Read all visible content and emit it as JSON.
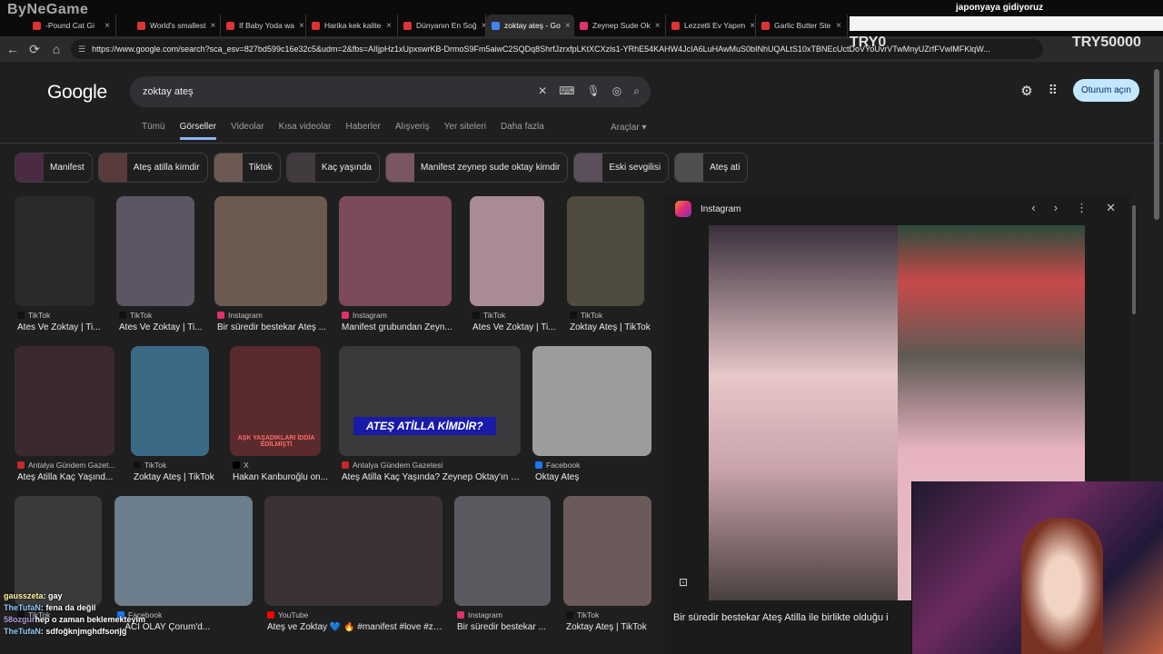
{
  "browser": {
    "tabs": [
      {
        "label": "-Pound Cat Gi",
        "color": "#d33"
      },
      {
        "label": "World's smallest",
        "color": "#d33"
      },
      {
        "label": "If Baby Yoda wa",
        "color": "#d33"
      },
      {
        "label": "Harika kek kalite",
        "color": "#d33"
      },
      {
        "label": "Dünyanın En Soğ",
        "color": "#d33"
      },
      {
        "label": "zoktay ateş - Go",
        "color": "#4285f4"
      },
      {
        "label": "Zeynep Sude Ok",
        "color": "#e1306c"
      },
      {
        "label": "Lezzetli Ev Yapım",
        "color": "#d33"
      },
      {
        "label": "Garlic Butter Ste",
        "color": "#d33"
      }
    ],
    "url": "https://www.google.com/search?sca_esv=827bd599c16e32c5&udm=2&fbs=AIIjpHz1xUpxswrKB-DrmoS9Fm5aiwC2SQDq8ShrfJzrxfpLKtXCXzls1-YRhE54KAHW4JcIA6LuHAwMuS0bINhUQALtS10xTBNEcUctDoVYoUvrVTwMnyUZrfFVwlMFKlqW..."
  },
  "stream": {
    "logo": "ByNeGame",
    "goal_text": "japonyaya gidiyoruz",
    "goal_current": "TRY0",
    "goal_target": "TRY50000"
  },
  "google": {
    "logo": "Google",
    "query": "zoktay ateş",
    "signin": "Oturum açın",
    "tabs": [
      "Tümü",
      "Görseller",
      "Videolar",
      "Kısa videolar",
      "Haberler",
      "Alışveriş",
      "Yer siteleri",
      "Daha fazla"
    ],
    "tools": "Araçlar",
    "chips": [
      {
        "label": "Manifest",
        "color": "#4b2b44"
      },
      {
        "label": "Ateş atilla kimdir",
        "color": "#5a3b3b"
      },
      {
        "label": "Tiktok",
        "color": "#6c5a52"
      },
      {
        "label": "Kaç yaşında",
        "color": "#413a3f"
      },
      {
        "label": "Manifest zeynep sude oktay kimdir",
        "color": "#7a5660"
      },
      {
        "label": "Eski sevgilisi",
        "color": "#5a4f5a"
      },
      {
        "label": "Ateş ati",
        "color": "#4f4f4f"
      }
    ],
    "results_row1": [
      {
        "source": "TikTok",
        "title": "Ates Ve Zoktay | Ti...",
        "color": "#2a2a2a",
        "srccolor": "#111"
      },
      {
        "source": "TikTok",
        "title": "Ates Ve Zoktay | Ti...",
        "color": "#5c5564",
        "srccolor": "#111"
      },
      {
        "source": "Instagram",
        "title": "Bir süredir bestekar Ateş ...",
        "color": "#6b5a50",
        "srccolor": "#e1306c"
      },
      {
        "source": "Instagram",
        "title": "Manifest grubundan Zeyn...",
        "color": "#7b4b5a",
        "srccolor": "#e1306c"
      },
      {
        "source": "TikTok",
        "title": "Ates Ve Zoktay | Ti...",
        "color": "#a88b96",
        "srccolor": "#111"
      },
      {
        "source": "TikTok",
        "title": "Zoktay Ateş | TikTok",
        "color": "#4e4a3e",
        "srccolor": "#111"
      }
    ],
    "results_row2": [
      {
        "source": "Antalya Gündem Gazet...",
        "title": "Ateş Atilla Kaç Yaşınd...",
        "color": "#3a2a2e",
        "srccolor": "#c62828"
      },
      {
        "source": "TikTok",
        "title": "Zoktay Ateş | TikTok",
        "color": "#3b6a86",
        "srccolor": "#111"
      },
      {
        "source": "X",
        "title": "Hakan Kanburoğlu on...",
        "color": "#5a2a2c",
        "srccolor": "#000"
      },
      {
        "source": "Antalya Gündem Gazetesi",
        "title": "Ateş Atilla Kaç Yaşında? Zeynep Oktay'ın S...",
        "color": "#3a3a3c",
        "srccolor": "#c62828"
      },
      {
        "source": "Facebook",
        "title": "Oktay Ateş",
        "color": "#9c9c9c",
        "srccolor": "#1877f2"
      }
    ],
    "results_row3": [
      {
        "source": "TikTok",
        "title": "",
        "color": "#3a3a3a",
        "srccolor": "#111"
      },
      {
        "source": "Facebook",
        "title": "...ACI OLAY Çorum'd...",
        "color": "#6c7d8c",
        "srccolor": "#1877f2"
      },
      {
        "source": "YouTube",
        "title": "Ateş ve Zoktay 💙 🔥 #manifest #love #zo...",
        "color": "#3a3232",
        "srccolor": "#ff0000"
      },
      {
        "source": "Instagram",
        "title": "Bir süredir bestekar ...",
        "color": "#5a5a60",
        "srccolor": "#e1306c"
      },
      {
        "source": "TikTok",
        "title": "Zoktay Ateş | TikTok",
        "color": "#6a5a5a",
        "srccolor": "#111"
      }
    ],
    "badge_text": "ATEŞ ATİLLA KİMDİR?",
    "ask_text": "AŞK YAŞADIKLARI İDDİA EDİLMİŞTİ",
    "panel": {
      "source": "Instagram",
      "caption": "Bir süredir bestekar Ateş Atilla ile birlikte olduğu i"
    }
  },
  "chat": [
    {
      "user": "gausszeta",
      "msg": ": gay"
    },
    {
      "user": "TheTufaN",
      "msg": ": fena da değil"
    },
    {
      "user": "58ozgur",
      "msg": "hep o zaman beklemekteyim"
    },
    {
      "user": "TheTufaN",
      "msg": ": sdfoğknjmghdfsonjg"
    }
  ]
}
